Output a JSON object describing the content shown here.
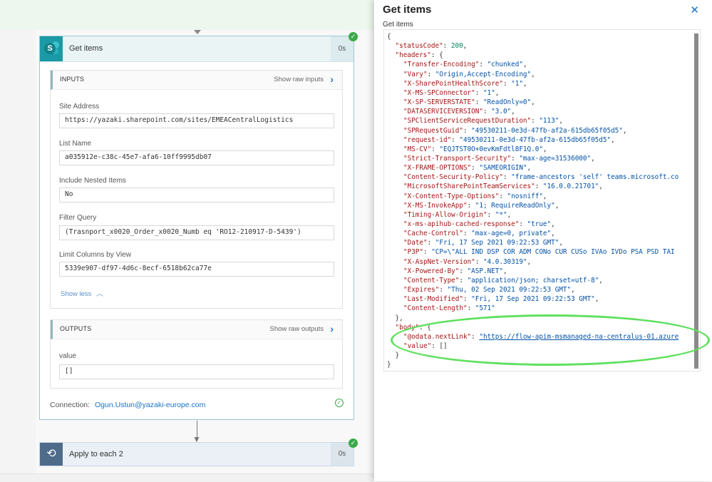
{
  "flow": {
    "step1": {
      "title": "Get items",
      "duration": "0s",
      "inputs": {
        "title": "INPUTS",
        "raw_label": "Show raw inputs",
        "fields": [
          {
            "label": "Site Address",
            "value": "https://yazaki.sharepoint.com/sites/EMEACentralLogistics"
          },
          {
            "label": "List Name",
            "value": "a035912e-c38c-45e7-afa6-10ff9995db07"
          },
          {
            "label": "Include Nested Items",
            "value": "No"
          },
          {
            "label": "Filter Query",
            "value": "(Trasnport_x0020_Order_x0020_Numb eq 'RO12-210917-D-5439')"
          },
          {
            "label": "Limit Columns by View",
            "value": "5339e907-df97-4d6c-8ecf-6518b62ca77e"
          }
        ],
        "show_less": "Show less"
      },
      "outputs": {
        "title": "OUTPUTS",
        "raw_label": "Show raw outputs",
        "field_label": "value",
        "field_value": "[]"
      },
      "connection_label": "Connection:",
      "connection_value": "Ogun.Ustun@yazaki-europe.com"
    },
    "step2": {
      "title": "Apply to each 2",
      "duration": "0s"
    }
  },
  "panel": {
    "title": "Get items",
    "close": "✕",
    "subtitle": "Get items",
    "json_lines": [
      {
        "indent": 0,
        "punct": "{"
      },
      {
        "indent": 1,
        "key": "\"statusCode\"",
        "sep": ": ",
        "num": "200",
        "end": ","
      },
      {
        "indent": 1,
        "key": "\"headers\"",
        "sep": ": ",
        "end": "{"
      },
      {
        "indent": 2,
        "key": "\"Transfer-Encoding\"",
        "sep": ": ",
        "str": "\"chunked\"",
        "end": ","
      },
      {
        "indent": 2,
        "key": "\"Vary\"",
        "sep": ": ",
        "str": "\"Origin,Accept-Encoding\"",
        "end": ","
      },
      {
        "indent": 2,
        "key": "\"X-SharePointHealthScore\"",
        "sep": ": ",
        "str": "\"1\"",
        "end": ","
      },
      {
        "indent": 2,
        "key": "\"X-MS-SPConnector\"",
        "sep": ": ",
        "str": "\"1\"",
        "end": ","
      },
      {
        "indent": 2,
        "key": "\"X-SP-SERVERSTATE\"",
        "sep": ": ",
        "str": "\"ReadOnly=0\"",
        "end": ","
      },
      {
        "indent": 2,
        "key": "\"DATASERVICEVERSION\"",
        "sep": ": ",
        "str": "\"3.0\"",
        "end": ","
      },
      {
        "indent": 2,
        "key": "\"SPClientServiceRequestDuration\"",
        "sep": ": ",
        "str": "\"113\"",
        "end": ","
      },
      {
        "indent": 2,
        "key": "\"SPRequestGuid\"",
        "sep": ": ",
        "str": "\"49530211-0e3d-47fb-af2a-615db65f05d5\"",
        "end": ","
      },
      {
        "indent": 2,
        "key": "\"request-id\"",
        "sep": ": ",
        "str": "\"49530211-0e3d-47fb-af2a-615db65f05d5\"",
        "end": ","
      },
      {
        "indent": 2,
        "key": "\"MS-CV\"",
        "sep": ": ",
        "str": "\"EQJTST0O+0evKmFdtl8F1Q.0\"",
        "end": ","
      },
      {
        "indent": 2,
        "key": "\"Strict-Transport-Security\"",
        "sep": ": ",
        "str": "\"max-age=31536000\"",
        "end": ","
      },
      {
        "indent": 2,
        "key": "\"X-FRAME-OPTIONS\"",
        "sep": ": ",
        "str": "\"SAMEORIGIN\"",
        "end": ","
      },
      {
        "indent": 2,
        "key": "\"Content-Security-Policy\"",
        "sep": ": ",
        "str": "\"frame-ancestors 'self' teams.microsoft.co",
        "end": ""
      },
      {
        "indent": 2,
        "key": "\"MicrosoftSharePointTeamServices\"",
        "sep": ": ",
        "str": "\"16.0.0.21701\"",
        "end": ","
      },
      {
        "indent": 2,
        "key": "\"X-Content-Type-Options\"",
        "sep": ": ",
        "str": "\"nosniff\"",
        "end": ","
      },
      {
        "indent": 2,
        "key": "\"X-MS-InvokeApp\"",
        "sep": ": ",
        "str": "\"1; RequireReadOnly\"",
        "end": ","
      },
      {
        "indent": 2,
        "key": "\"Timing-Allow-Origin\"",
        "sep": ": ",
        "str": "\"*\"",
        "end": ","
      },
      {
        "indent": 2,
        "key": "\"x-ms-apihub-cached-response\"",
        "sep": ": ",
        "str": "\"true\"",
        "end": ","
      },
      {
        "indent": 2,
        "key": "\"Cache-Control\"",
        "sep": ": ",
        "str": "\"max-age=0, private\"",
        "end": ","
      },
      {
        "indent": 2,
        "key": "\"Date\"",
        "sep": ": ",
        "str": "\"Fri, 17 Sep 2021 09:22:53 GMT\"",
        "end": ","
      },
      {
        "indent": 2,
        "key": "\"P3P\"",
        "sep": ": ",
        "str": "\"CP=\\\"ALL IND DSP COR ADM CONo CUR CUSo IVAo IVDo PSA PSD TAI",
        "end": ""
      },
      {
        "indent": 2,
        "key": "\"X-AspNet-Version\"",
        "sep": ": ",
        "str": "\"4.0.30319\"",
        "end": ","
      },
      {
        "indent": 2,
        "key": "\"X-Powered-By\"",
        "sep": ": ",
        "str": "\"ASP.NET\"",
        "end": ","
      },
      {
        "indent": 2,
        "key": "\"Content-Type\"",
        "sep": ": ",
        "str": "\"application/json; charset=utf-8\"",
        "end": ","
      },
      {
        "indent": 2,
        "key": "\"Expires\"",
        "sep": ": ",
        "str": "\"Thu, 02 Sep 2021 09:22:53 GMT\"",
        "end": ","
      },
      {
        "indent": 2,
        "key": "\"Last-Modified\"",
        "sep": ": ",
        "str": "\"Fri, 17 Sep 2021 09:22:53 GMT\"",
        "end": ","
      },
      {
        "indent": 2,
        "key": "\"Content-Length\"",
        "sep": ": ",
        "str": "\"571\"",
        "end": ""
      },
      {
        "indent": 1,
        "punct": "},"
      },
      {
        "indent": 1,
        "key": "\"body\"",
        "sep": ": ",
        "end": "{"
      },
      {
        "indent": 2,
        "key": "\"@odata.nextLink\"",
        "sep": ": ",
        "link": "\"https://flow-apim-msmanaged-na-centralus-01.azure",
        "end": ""
      },
      {
        "indent": 2,
        "key": "\"value\"",
        "sep": ": ",
        "end": "[]"
      },
      {
        "indent": 1,
        "punct": "}"
      },
      {
        "indent": 0,
        "punct": "}"
      }
    ]
  },
  "colors": {
    "accent": "#1a73c8",
    "success": "#3caa4a",
    "highlight": "#5fe05f"
  },
  "icons": [
    "sharepoint-icon",
    "check-icon",
    "chevron-right-icon",
    "chevron-up-icon",
    "loop-icon",
    "close-icon"
  ]
}
